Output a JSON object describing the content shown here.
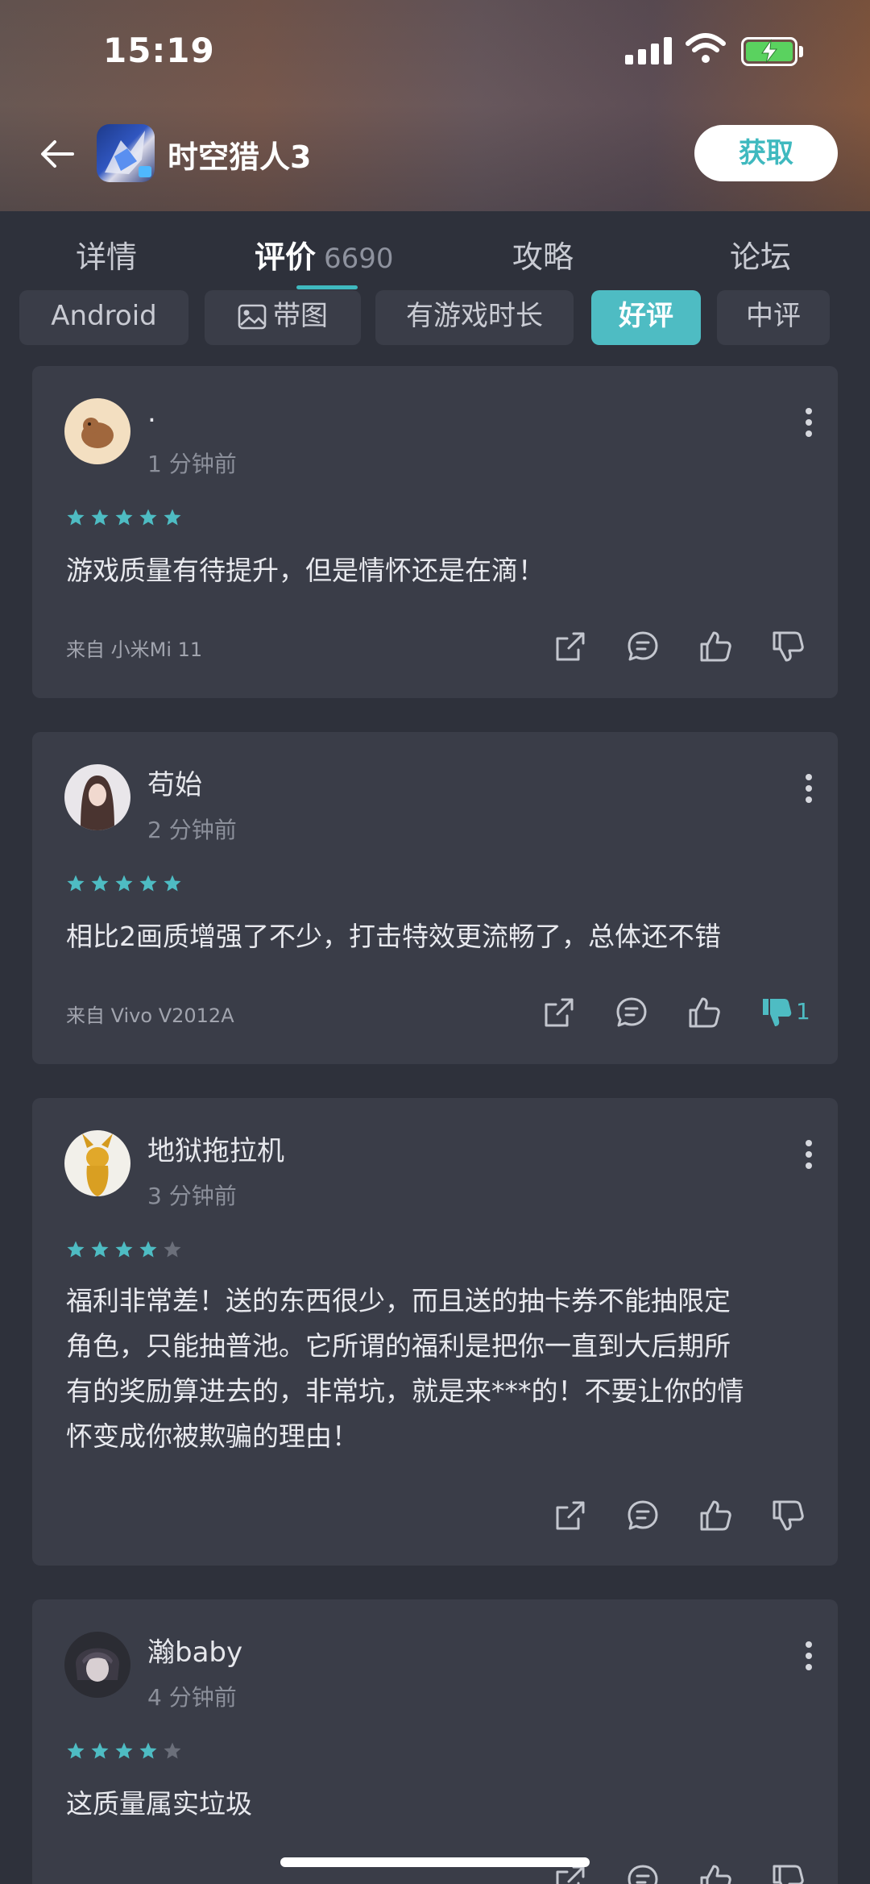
{
  "status": {
    "time": "15:19"
  },
  "header": {
    "app_title": "时空猎人3",
    "get_label": "获取"
  },
  "tabs": [
    {
      "label": "详情"
    },
    {
      "label": "评价",
      "count": "6690"
    },
    {
      "label": "攻略"
    },
    {
      "label": "论坛"
    }
  ],
  "filters": [
    "Android",
    "带图",
    "有游戏时长",
    "好评",
    "中评"
  ],
  "active_filter": "好评",
  "colors": {
    "accent": "#4ebcc3",
    "card": "#3a3d48",
    "background": "#2e313b"
  },
  "reviews": [
    {
      "username": ".",
      "time": "1 分钟前",
      "rating": 5,
      "content": [
        "游戏质量有待提升，但是情怀还是在滴！"
      ],
      "device": "来自 小米Mi 11",
      "dislike_count": ""
    },
    {
      "username": "苟始",
      "time": "2 分钟前",
      "rating": 5,
      "content": [
        "相比2画质增强了不少，打击特效更流畅了，总体还不错"
      ],
      "device": "来自 Vivo V2012A",
      "dislike_count": "1"
    },
    {
      "username": "地狱拖拉机",
      "time": "3 分钟前",
      "rating": 4,
      "content": [
        "福利非常差！送的东西很少，而且送的抽卡券不能抽限定",
        "角色，只能抽普池。它所谓的福利是把你一直到大后期所",
        "有的奖励算进去的，非常坑，就是来***的！不要让你的情",
        "怀变成你被欺骗的理由！"
      ],
      "device": "",
      "dislike_count": ""
    },
    {
      "username": "瀚baby",
      "time": "4 分钟前",
      "rating": 4,
      "content": [
        "这质量属实垃圾"
      ],
      "device": "",
      "dislike_count": ""
    }
  ]
}
